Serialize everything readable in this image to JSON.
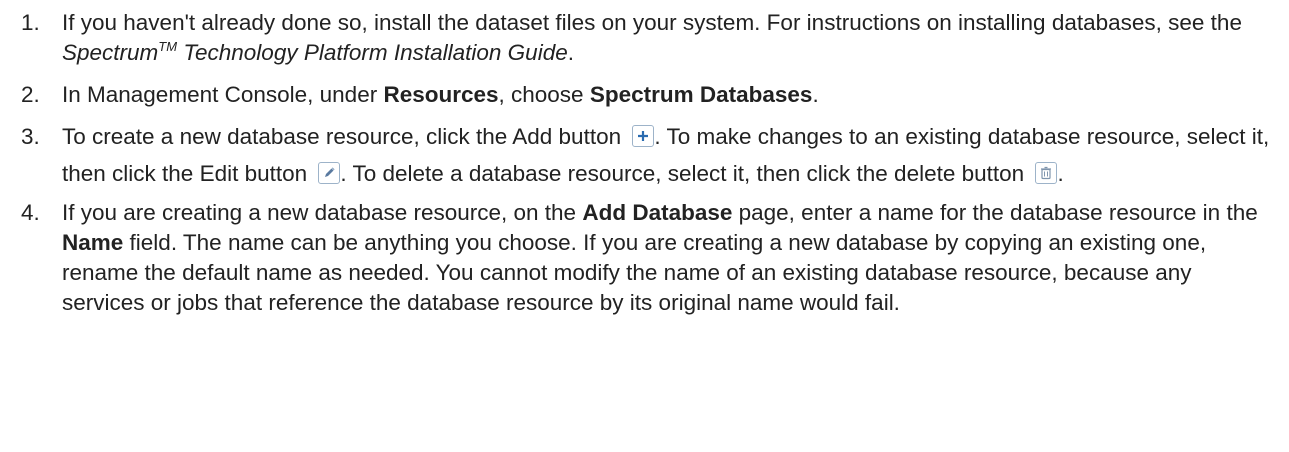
{
  "steps": [
    {
      "num": "1.",
      "text_a": "If you haven't already done so, install the dataset files on your system. For instructions on installing databases, see the ",
      "guide_name": "Spectrum",
      "tm": "TM",
      "guide_rest": " Technology Platform Installation Guide",
      "text_b": "."
    },
    {
      "num": "2.",
      "text_a": "In Management Console, under ",
      "bold_a": "Resources",
      "text_b": ", choose ",
      "bold_b": "Spectrum Databases",
      "text_c": "."
    },
    {
      "num": "3.",
      "text_a": "To create a new database resource, click the Add button ",
      "text_b": ". To make changes to an existing database resource, select it, then click the Edit button ",
      "text_c": ". To delete a database resource, select it, then click the delete button ",
      "text_d": "."
    },
    {
      "num": "4.",
      "text_a": "If you are creating a new database resource, on the ",
      "bold_a": "Add Database",
      "text_b": " page, enter a name for the database resource in the ",
      "bold_b": "Name",
      "text_c": " field. The name can be anything you choose. If you are creating a new database by copying an existing one, rename the default name as needed. You cannot modify the name of an existing database resource, because any services or jobs that reference the database resource by its original name would fail."
    }
  ],
  "icons": {
    "add": "plus-icon",
    "edit": "pencil-icon",
    "delete": "trash-icon"
  },
  "colors": {
    "text": "#222222",
    "icon_border": "#9db3c9",
    "icon_glyph": "#2a6bb0"
  }
}
